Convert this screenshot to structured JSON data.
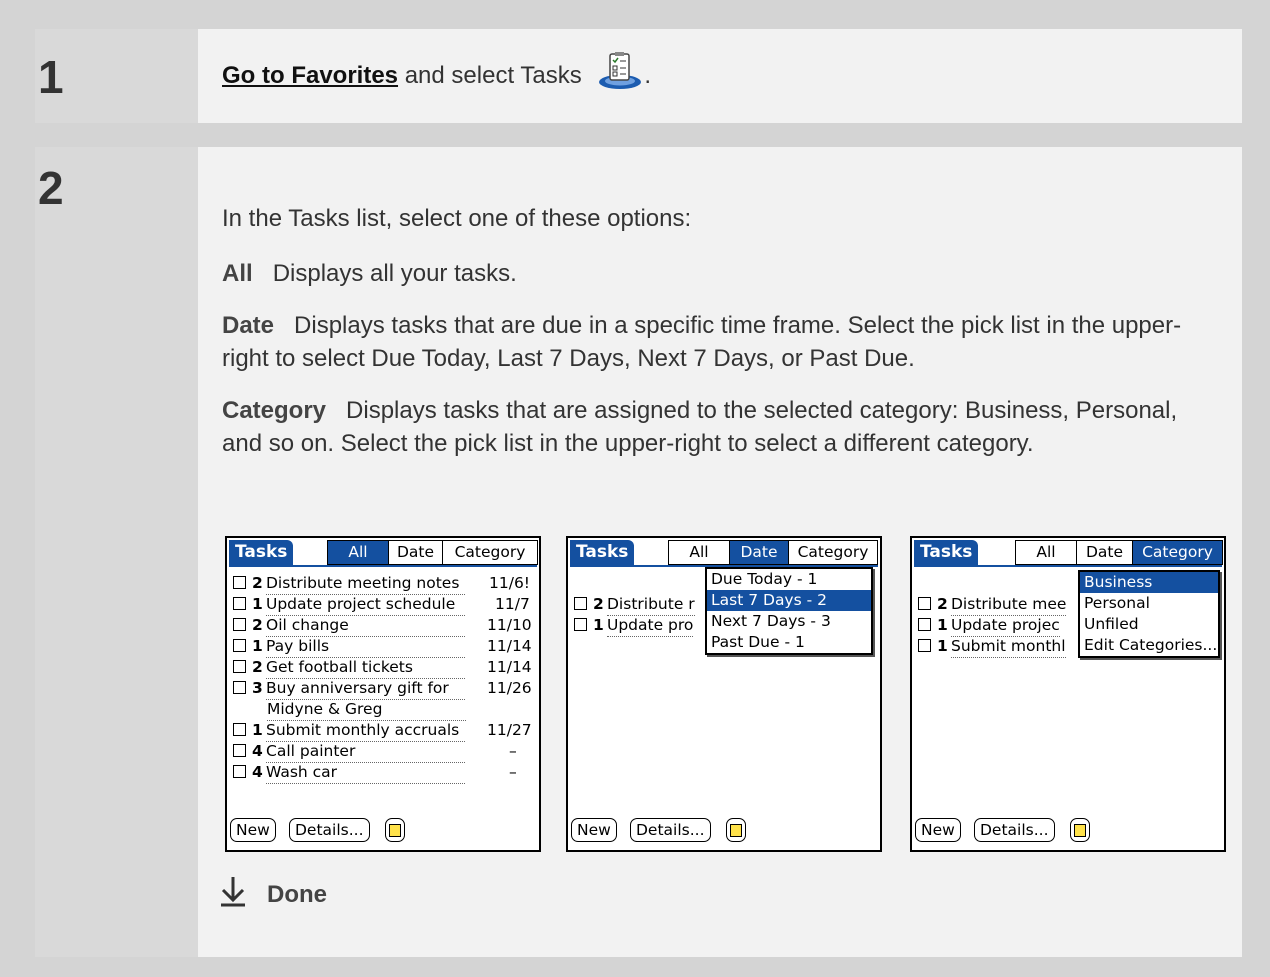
{
  "steps": [
    {
      "number": "1",
      "link": "Go to Favorites",
      "text_after_link": " and select Tasks ",
      "trailing": "."
    },
    {
      "number": "2",
      "intro": "In the Tasks list, select one of these options:",
      "options": [
        {
          "term": "All",
          "desc": "Displays all your tasks."
        },
        {
          "term": "Date",
          "desc": "Displays tasks that are due in a specific time frame. Select the pick list in the upper-right to select Due Today, Last 7 Days, Next 7 Days, or Past Due."
        },
        {
          "term": "Category",
          "desc": "Displays tasks that are assigned to the selected category: Business, Personal, and so on. Select the pick list in the upper-right to select a different category."
        }
      ]
    }
  ],
  "screens": [
    {
      "title": "Tasks",
      "tabs": [
        "All",
        "Date",
        "Category"
      ],
      "selected_tab": "All",
      "rows": [
        {
          "priority": "2",
          "desc": "Distribute meeting notes",
          "due": "11/6!"
        },
        {
          "priority": "1",
          "desc": "Update project schedule",
          "due": "11/7"
        },
        {
          "priority": "2",
          "desc": "Oil change",
          "due": "11/10"
        },
        {
          "priority": "1",
          "desc": "Pay bills",
          "due": "11/14"
        },
        {
          "priority": "2",
          "desc": "Get football tickets",
          "due": "11/14"
        },
        {
          "priority": "3",
          "desc": "Buy anniversary gift for",
          "due": "11/26"
        },
        {
          "priority": "",
          "desc": "Midyne & Greg",
          "due": ""
        },
        {
          "priority": "1",
          "desc": "Submit monthly accruals",
          "due": "11/27"
        },
        {
          "priority": "4",
          "desc": "Call painter",
          "due": "–"
        },
        {
          "priority": "4",
          "desc": "Wash car",
          "due": "–"
        }
      ],
      "buttons": [
        "New",
        "Details..."
      ]
    },
    {
      "title": "Tasks",
      "tabs": [
        "All",
        "Date",
        "Category"
      ],
      "selected_tab": "Date",
      "rows": [
        {
          "priority": "2",
          "desc": "Distribute r"
        },
        {
          "priority": "1",
          "desc": "Update pro"
        }
      ],
      "popup": [
        "Due Today - 1",
        "Last 7 Days - 2",
        "Next 7 Days - 3",
        "Past Due - 1"
      ],
      "popup_selected": "Last 7 Days - 2",
      "buttons": [
        "New",
        "Details..."
      ]
    },
    {
      "title": "Tasks",
      "tabs": [
        "All",
        "Date",
        "Category"
      ],
      "selected_tab": "Category",
      "rows": [
        {
          "priority": "2",
          "desc": "Distribute mee"
        },
        {
          "priority": "1",
          "desc": "Update projec"
        },
        {
          "priority": "1",
          "desc": "Submit monthl"
        }
      ],
      "popup": [
        "Business",
        "Personal",
        "Unfiled",
        "Edit Categories..."
      ],
      "popup_selected": "Business",
      "buttons": [
        "New",
        "Details..."
      ]
    }
  ],
  "done_label": "Done",
  "colors": {
    "accent": "#1450a0",
    "panel": "#f2f2f2",
    "number_column": "#d9d9d9",
    "background": "#d4d4d4"
  }
}
